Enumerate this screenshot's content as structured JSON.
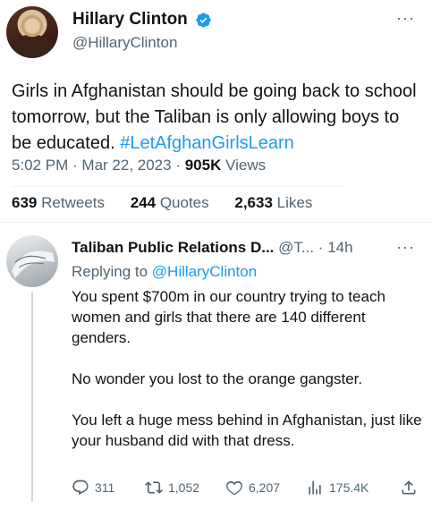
{
  "main_tweet": {
    "name": "Hillary Clinton",
    "handle": "@HillaryClinton",
    "text_plain": "Girls in Afghanistan should be going back to school tomorrow, but the Taliban is only allowing boys to be educated. ",
    "hashtag": "#LetAfghanGirlsLearn",
    "time": "5:02 PM · Mar 22, 2023 · ",
    "views_count": "905K",
    "views_label": " Views",
    "retweets_count": "639",
    "retweets_label": "Retweets",
    "quotes_count": "244",
    "quotes_label": "Quotes",
    "likes_count": "2,633",
    "likes_label": "Likes",
    "more": "···"
  },
  "reply": {
    "name": "Taliban Public Relations D...",
    "handle": "@T...",
    "sep": "·",
    "time": "14h",
    "replying_prefix": "Replying to ",
    "replying_mention": "@HillaryClinton",
    "body": [
      "You spent $700m in our country trying to teach women and girls that there are 140 different genders.",
      "No wonder you lost to the orange gangster.",
      "You left a huge mess behind in Afghanistan, just like your husband did with that dress."
    ],
    "more": "···",
    "actions": {
      "replies": "311",
      "retweets": "1,052",
      "likes": "6,207",
      "views": "175.4K"
    }
  },
  "icons": {
    "verified": "verified-badge-icon",
    "reply": "reply-icon",
    "retweet": "retweet-icon",
    "like": "heart-icon",
    "views": "views-chart-icon",
    "share": "share-icon"
  },
  "colors": {
    "accent": "#1d9bf0",
    "text": "#0f1419",
    "secondary": "#536471"
  }
}
